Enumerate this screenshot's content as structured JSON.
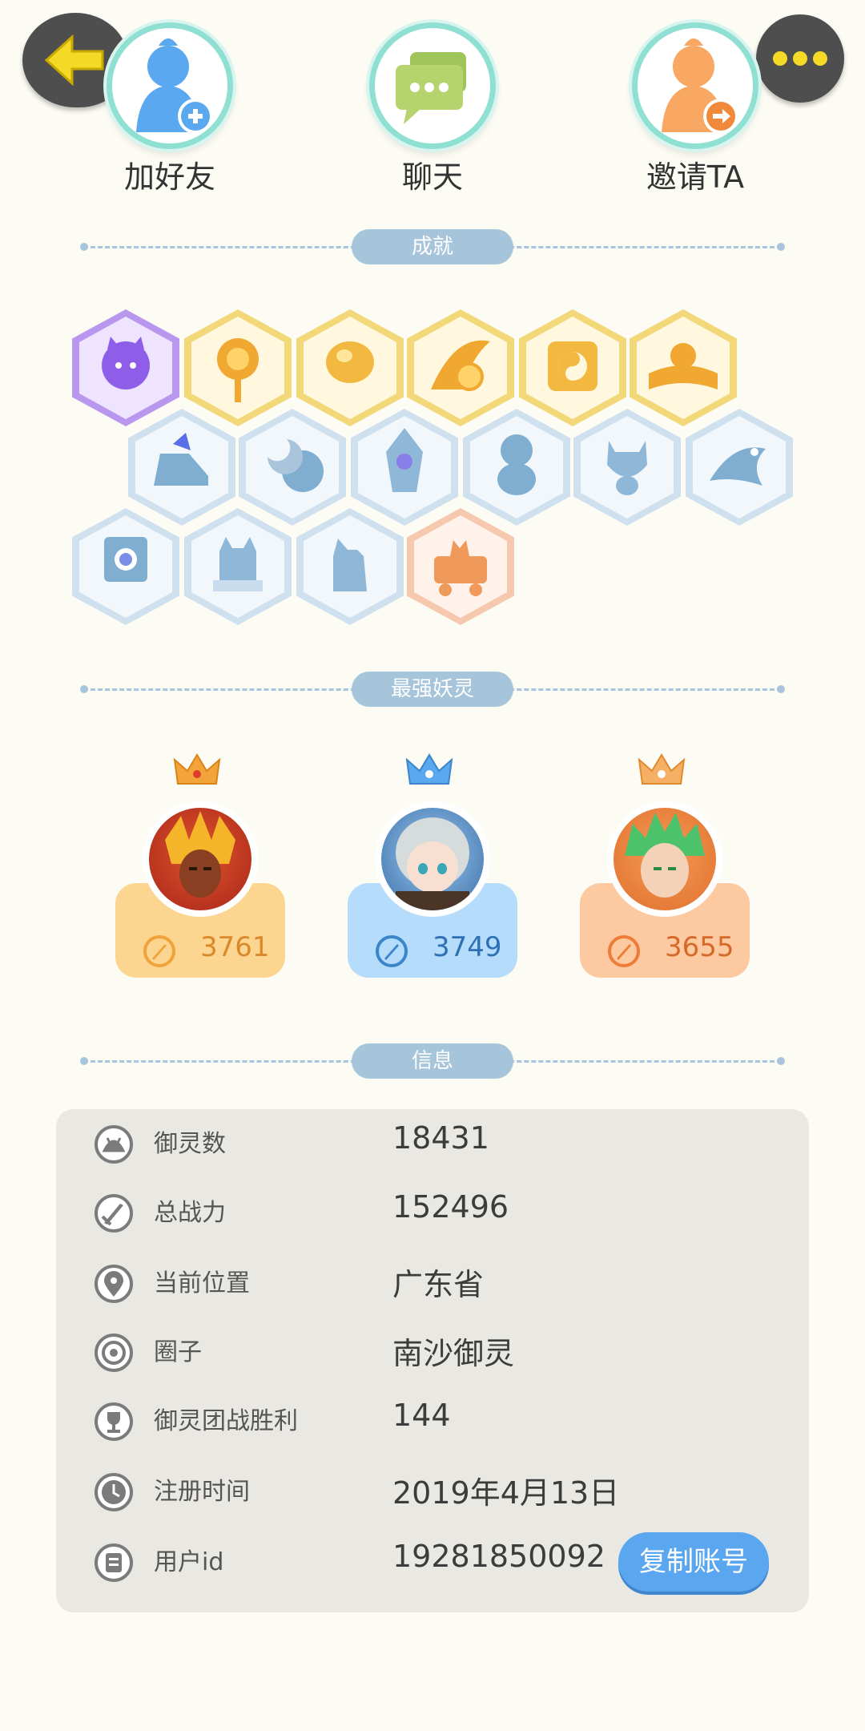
{
  "actions": [
    {
      "label": "加好友",
      "icon": "add-friend-icon"
    },
    {
      "label": "聊天",
      "icon": "chat-icon"
    },
    {
      "label": "邀请TA",
      "icon": "invite-icon"
    }
  ],
  "sections": {
    "achievements": "成就",
    "strongest": "最强妖灵",
    "info": "信息"
  },
  "achievement_icons": [
    "purple-cat-badge-icon",
    "sun-badge-icon",
    "orb-badge-icon",
    "yin-yang-orb-badge-icon",
    "yin-yang-box-badge-icon",
    "book-badge-icon",
    "sneaker-badge-icon",
    "moon-planet-badge-icon",
    "crystal-badge-icon",
    "ice-creature-badge-icon",
    "cat-spirit-badge-icon",
    "fish-badge-icon",
    "shield-badge-icon",
    "horned-spirit-badge-icon",
    "snow-cat-badge-icon",
    "cart-cat-badge-icon"
  ],
  "spirits": [
    {
      "power": "3761",
      "color": "#fcd690",
      "accent": "#f0a33a"
    },
    {
      "power": "3749",
      "color": "#b5dcfb",
      "accent": "#3b86c9"
    },
    {
      "power": "3655",
      "color": "#fdc9a0",
      "accent": "#ee7c37"
    }
  ],
  "info": [
    {
      "key": "御灵数",
      "value": "18431",
      "icon": "spirit-count-icon"
    },
    {
      "key": "总战力",
      "value": "152496",
      "icon": "sword-icon"
    },
    {
      "key": "当前位置",
      "value": "广东省",
      "icon": "location-pin-icon"
    },
    {
      "key": "圈子",
      "value": "南沙御灵",
      "icon": "circle-target-icon"
    },
    {
      "key": "御灵团战胜利",
      "value": "144",
      "icon": "trophy-icon"
    },
    {
      "key": "注册时间",
      "value": "2019年4月13日",
      "icon": "clock-icon"
    },
    {
      "key": "用户id",
      "value": "19281850092",
      "icon": "id-card-icon"
    }
  ],
  "copy_button": "复制账号",
  "colors": {
    "background": "#fdfcf4",
    "section_pill": "#a6c4da",
    "copy_button": "#5aa6ef",
    "back_arrow": "#f5d927"
  }
}
